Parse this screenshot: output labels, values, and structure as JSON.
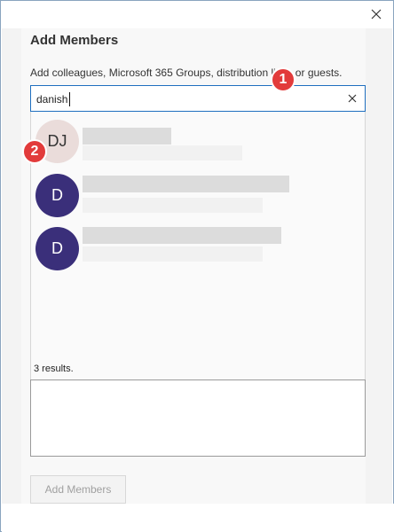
{
  "window": {
    "title": "Add Members",
    "description": "Add colleagues, Microsoft 365 Groups, distribution lists, or guests."
  },
  "search": {
    "value": "danish",
    "placeholder": ""
  },
  "results": {
    "items": [
      {
        "initials": "DJ"
      },
      {
        "initials": "D"
      },
      {
        "initials": "D"
      }
    ],
    "count_text": "3 results."
  },
  "footer": {
    "add_button_label": "Add Members"
  },
  "annotations": {
    "marker_1": "1",
    "marker_2": "2"
  },
  "colors": {
    "accent_border": "#1f6fbf",
    "avatar_light": "#eadcda",
    "avatar_dark": "#3a2f7a",
    "marker": "#e23b3b"
  }
}
